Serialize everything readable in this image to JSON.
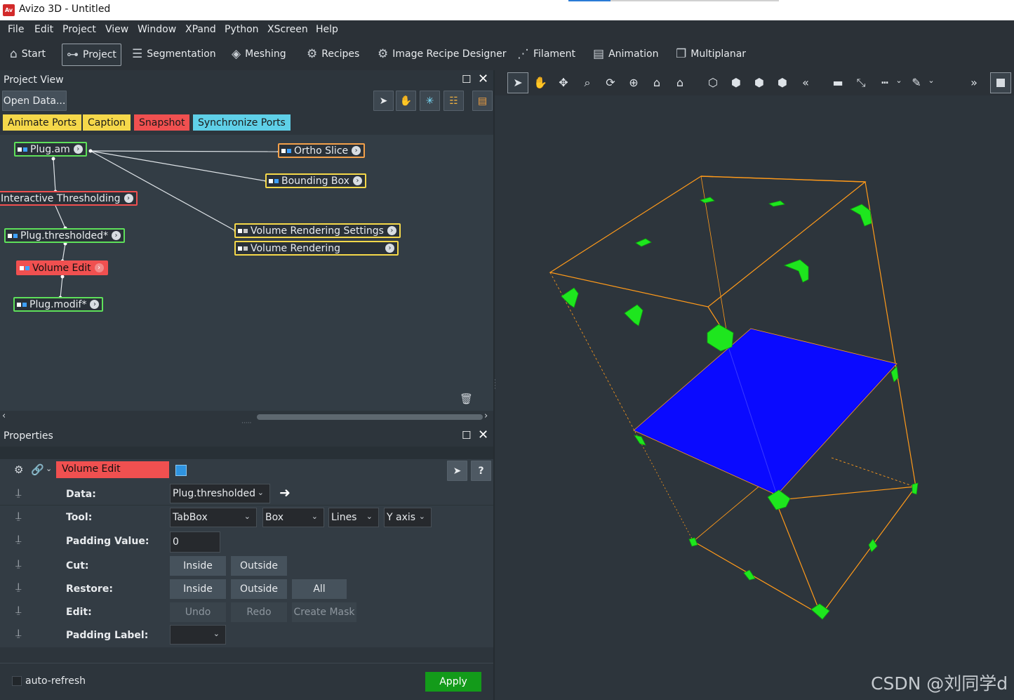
{
  "window": {
    "app_icon_text": "Av",
    "title": "Avizo 3D - Untitled"
  },
  "menubar": [
    "File",
    "Edit",
    "Project",
    "View",
    "Window",
    "XPand",
    "Python",
    "XScreen",
    "Help"
  ],
  "toolbar": {
    "start": "Start",
    "project": "Project",
    "segmentation": "Segmentation",
    "meshing": "Meshing",
    "recipes": "Recipes",
    "image_recipe_designer": "Image Recipe Designer",
    "filament": "Filament",
    "animation": "Animation",
    "multiplanar": "Multiplanar"
  },
  "project_view": {
    "title": "Project View",
    "open_data": "Open Data...",
    "chips": {
      "animate_ports": "Animate Ports",
      "caption": "Caption",
      "snapshot": "Snapshot",
      "synchronize_ports": "Synchronize Ports"
    },
    "nodes": {
      "plug_am": "Plug.am",
      "ortho_slice": "Ortho Slice",
      "bounding_box": "Bounding Box",
      "interactive_thresholding": "Interactive Thresholding",
      "plug_thresholded": "Plug.thresholded*",
      "volume_edit": "Volume Edit",
      "plug_modif": "Plug.modif*",
      "volume_rendering_settings": "Volume Rendering Settings",
      "volume_rendering": "Volume Rendering"
    }
  },
  "properties": {
    "title": "Properties",
    "module": "Volume Edit",
    "rows": {
      "data": {
        "label": "Data:",
        "value": "Plug.thresholded"
      },
      "tool": {
        "label": "Tool:",
        "tool": "TabBox",
        "shape": "Box",
        "style": "Lines",
        "axis": "Y axis"
      },
      "padding_value": {
        "label": "Padding Value:",
        "value": "0"
      },
      "cut": {
        "label": "Cut:",
        "inside": "Inside",
        "outside": "Outside"
      },
      "restore": {
        "label": "Restore:",
        "inside": "Inside",
        "outside": "Outside",
        "all": "All"
      },
      "edit": {
        "label": "Edit:",
        "undo": "Undo",
        "redo": "Redo",
        "create_mask": "Create Mask"
      },
      "padding_label": {
        "label": "Padding Label:",
        "value": ""
      }
    },
    "auto_refresh": "auto-refresh",
    "apply": "Apply"
  },
  "viewer": {
    "watermark": "CSDN @刘同学d",
    "colors": {
      "box_edges": "#ff9a1a",
      "handles": "#1ee61e",
      "slice": "#0a0aff",
      "background": "#2d353c"
    }
  }
}
